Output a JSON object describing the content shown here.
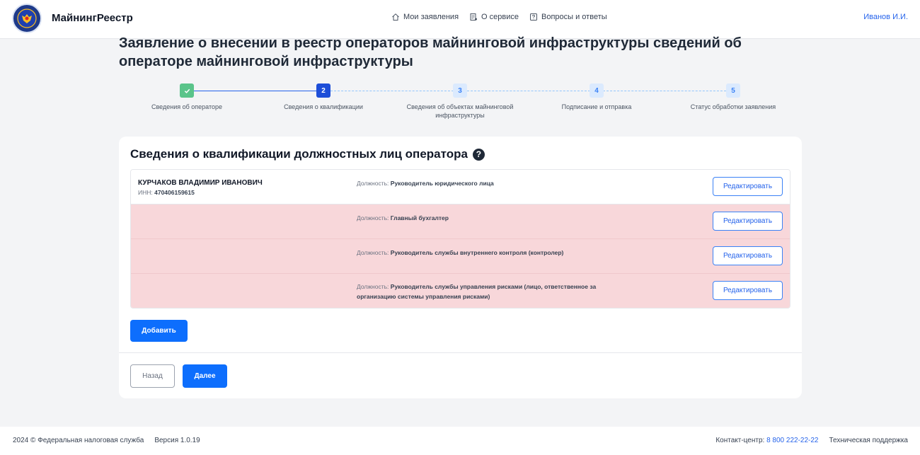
{
  "header": {
    "app_title": "МайнингРеестр",
    "nav": [
      {
        "label": "Мои заявления",
        "icon": "home-icon"
      },
      {
        "label": "О сервисе",
        "icon": "document-icon"
      },
      {
        "label": "Вопросы и ответы",
        "icon": "question-icon"
      }
    ],
    "user": "Иванов И.И."
  },
  "page_title": "Заявление о внесении в реестр операторов майнинговой инфраструктуры сведений об операторе майнинговой инфраструктуры",
  "stepper": {
    "steps": [
      {
        "number": "",
        "label": "Сведения об операторе",
        "state": "done"
      },
      {
        "number": "2",
        "label": "Сведения о квалификации",
        "state": "active"
      },
      {
        "number": "3",
        "label": "Сведения об объектах майнинговой инфраструктуры",
        "state": "todo"
      },
      {
        "number": "4",
        "label": "Подписание и отправка",
        "state": "todo"
      },
      {
        "number": "5",
        "label": "Статус обработки заявления",
        "state": "todo"
      }
    ]
  },
  "card": {
    "title": "Сведения о квалификации должностных лиц оператора",
    "help_icon": "?",
    "position_prefix": "Должность:",
    "inn_prefix": "ИНН:",
    "edit_label": "Редактировать",
    "rows": [
      {
        "name": "КУРЧАКОВ ВЛАДИМИР ИВАНОВИЧ",
        "inn": "470406159615",
        "position": "Руководитель юридического лица",
        "status": "ok"
      },
      {
        "name": "",
        "inn": "",
        "position": "Главный бухгалтер",
        "status": "error"
      },
      {
        "name": "",
        "inn": "",
        "position": "Руководитель службы внутреннего контроля (контролер)",
        "status": "error"
      },
      {
        "name": "",
        "inn": "",
        "position": "Руководитель службы управления рисками (лицо, ответственное за организацию системы управления рисками)",
        "status": "error"
      }
    ],
    "add_label": "Добавить",
    "back_label": "Назад",
    "next_label": "Далее"
  },
  "footer": {
    "copyright": "2024 © Федеральная налоговая служба",
    "version": "Версия 1.0.19",
    "contact_prefix": "Контакт-центр:",
    "contact_phone": "8 800 222-22-22",
    "support": "Техническая поддержка"
  },
  "colors": {
    "accent": "#0d6efd",
    "error_row": "#f8d7da",
    "done_step": "#5ac48a"
  }
}
